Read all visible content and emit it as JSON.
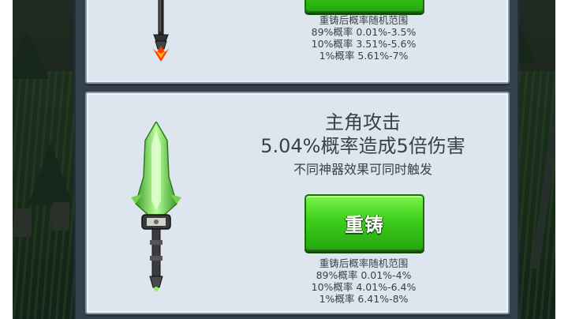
{
  "top_card": {
    "button_label": "",
    "stats": {
      "heading": "重铸后概率随机范围",
      "lines": [
        "89%概率 0.01%-3.5%",
        "10%概率 3.51%-5.6%",
        "1%概率 5.61%-7%"
      ]
    }
  },
  "main_card": {
    "title_line1": "主角攻击",
    "title_line2": "5.04%概率造成5倍伤害",
    "subtitle": "不同神器效果可同时触发",
    "button_label": "重铸",
    "stats": {
      "heading": "重铸后概率随机范围",
      "lines": [
        "89%概率 0.01%-4%",
        "10%概率 4.01%-6.4%",
        "1%概率 6.41%-8%"
      ]
    }
  },
  "colors": {
    "button_green": "#3fcf1d",
    "card_bg": "#dde6ee",
    "panel_bg": "#33404d"
  },
  "icons": {
    "top_weapon": "dark-sword-icon",
    "main_weapon": "jade-greatsword-icon"
  }
}
